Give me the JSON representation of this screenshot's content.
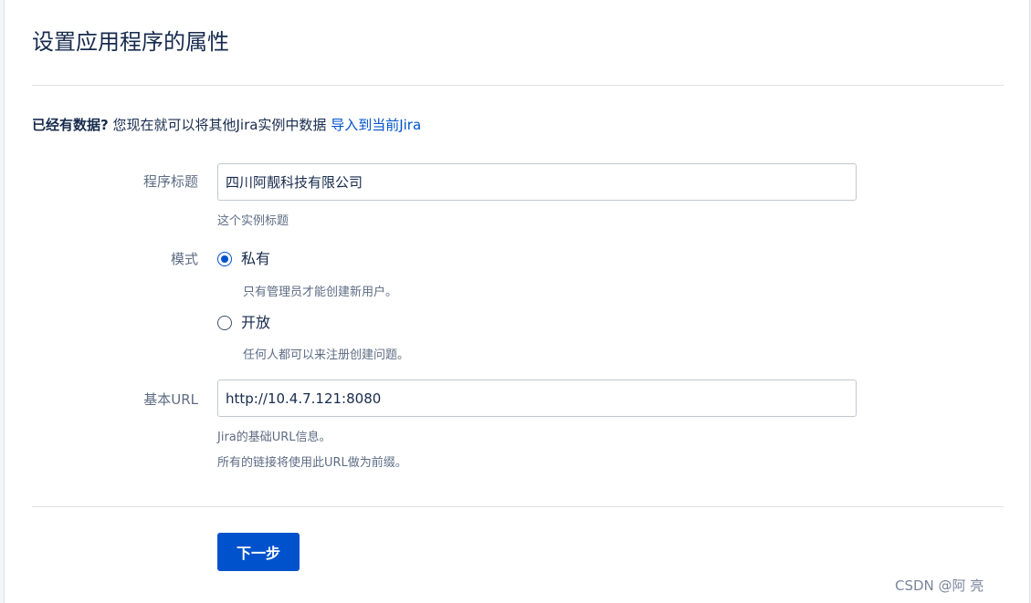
{
  "header": {
    "title": "设置应用程序的属性"
  },
  "import_notice": {
    "strong_text": "已经有数据?",
    "text": " 您现在就可以将其他Jira实例中数据 ",
    "link_text": "导入到当前Jira"
  },
  "form": {
    "app_title": {
      "label": "程序标题",
      "value": "四川阿靓科技有限公司",
      "help": "这个实例标题"
    },
    "mode": {
      "label": "模式",
      "options": [
        {
          "label": "私有",
          "description": "只有管理员才能创建新用户。",
          "selected": true
        },
        {
          "label": "开放",
          "description": "任何人都可以来注册创建问题。",
          "selected": false
        }
      ]
    },
    "base_url": {
      "label": "基本URL",
      "value": "http://10.4.7.121:8080",
      "help_line1": "Jira的基础URL信息。",
      "help_line2": "所有的链接将使用此URL做为前缀。"
    }
  },
  "actions": {
    "next_label": "下一步"
  },
  "watermark": "CSDN @阿 亮",
  "colors": {
    "primary": "#0052cc",
    "text": "#172b4d",
    "subtle_text": "#5e6c84",
    "border": "#dfe1e6"
  }
}
